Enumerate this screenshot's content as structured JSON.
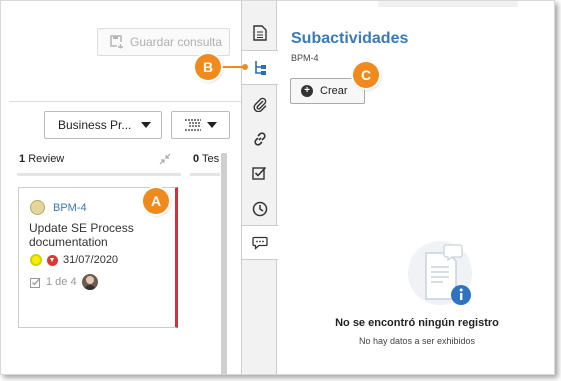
{
  "left": {
    "save_query_label": "Guardar consulta",
    "process_dropdown_label": "Business Pr...",
    "columns": [
      {
        "count": "1",
        "label": "Review"
      },
      {
        "count": "0",
        "label": "Tes"
      }
    ],
    "card": {
      "id": "BPM-4",
      "title": "Update SE Process documentation",
      "date": "31/07/2020",
      "counter": "1 de 4"
    }
  },
  "rail": {
    "items": [
      "document-icon",
      "subactivity-tree-icon",
      "attachment-icon",
      "link-icon",
      "checklist-icon",
      "clock-icon",
      "comment-icon"
    ]
  },
  "panel": {
    "title": "Subactividades",
    "record_id": "BPM-4",
    "create_label": "Crear",
    "empty_title": "No se encontró ningún registro",
    "empty_subtitle": "No hay datos a ser exhibidos"
  },
  "markers": {
    "a": "A",
    "b": "B",
    "c": "C"
  },
  "colors": {
    "accent": "#3a7ab8",
    "marker": "#f08a1c",
    "card_border": "#d32f43"
  }
}
